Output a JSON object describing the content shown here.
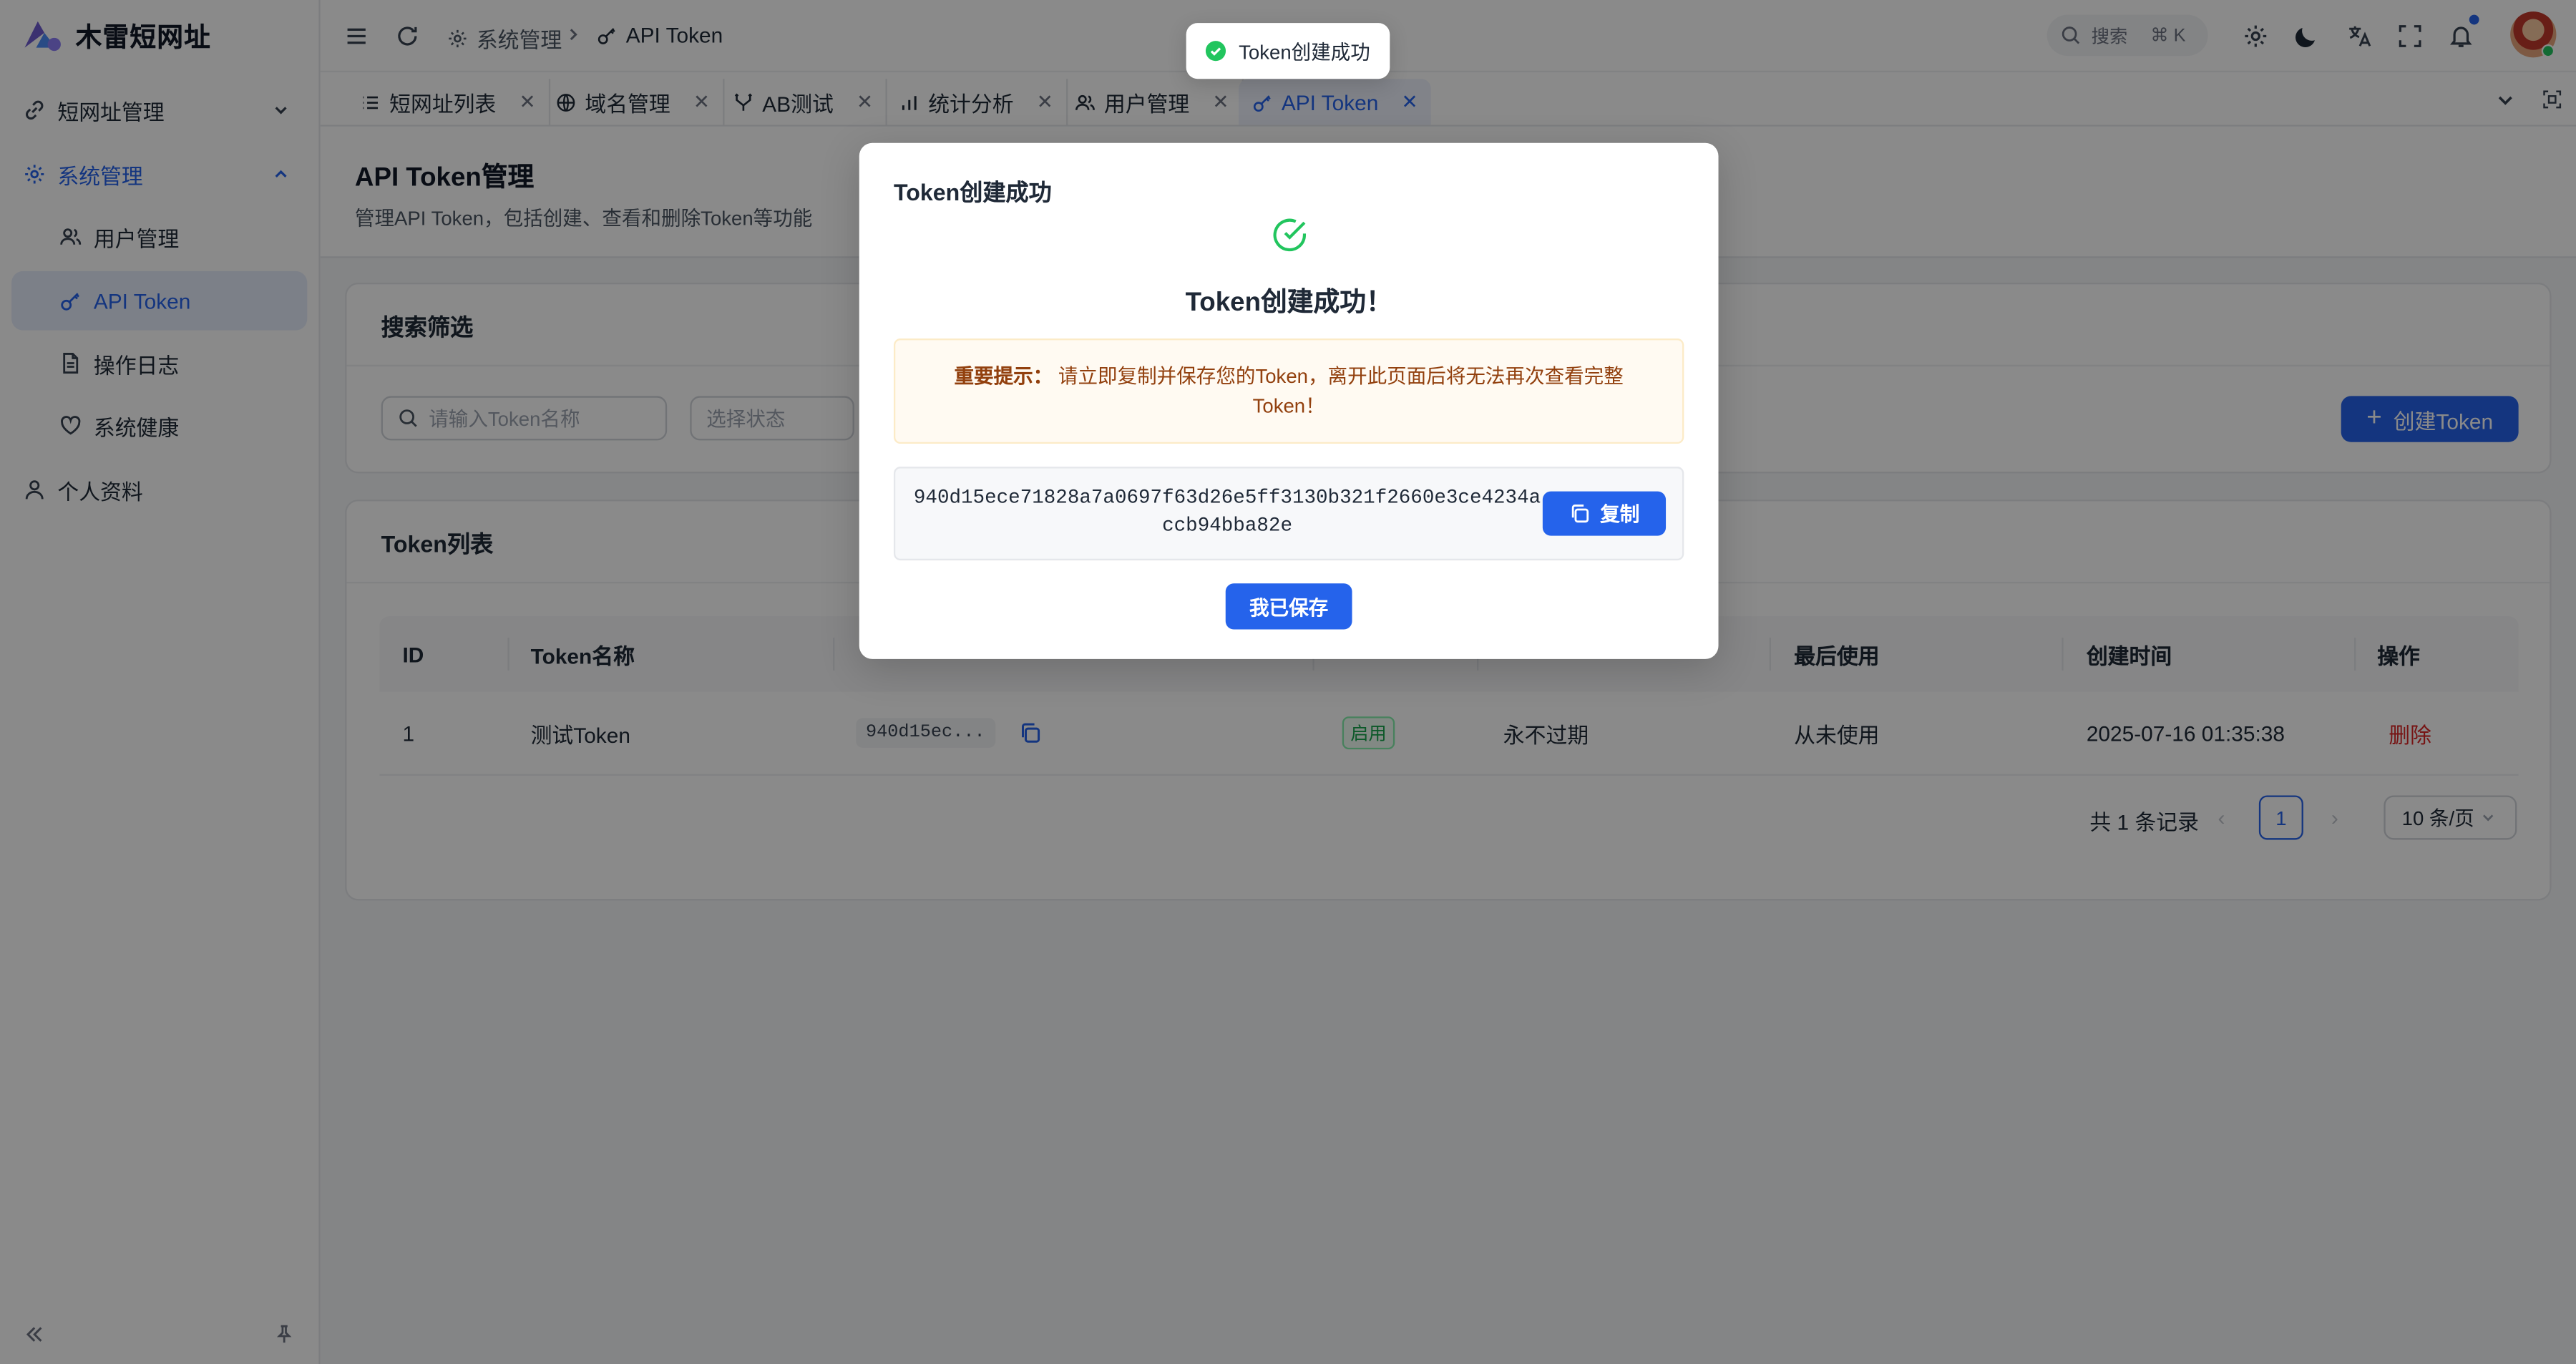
{
  "app": {
    "title": "木雷短网址"
  },
  "sidebar": {
    "groups": [
      {
        "label": "短网址管理",
        "icon": "link-icon"
      },
      {
        "label": "系统管理",
        "icon": "gear-icon"
      }
    ],
    "sub_items": [
      {
        "label": "用户管理",
        "icon": "users-icon"
      },
      {
        "label": "API Token",
        "icon": "key-icon"
      },
      {
        "label": "操作日志",
        "icon": "file-text-icon"
      },
      {
        "label": "系统健康",
        "icon": "heart-icon"
      }
    ],
    "profile": {
      "label": "个人资料",
      "icon": "user-icon"
    },
    "selected": "API Token"
  },
  "header": {
    "breadcrumb": [
      {
        "label": "系统管理",
        "icon": "gear-icon"
      },
      {
        "label": "API Token",
        "icon": "key-icon"
      }
    ],
    "search": {
      "label": "搜索",
      "shortcut": "⌘ K"
    }
  },
  "tabs": [
    {
      "label": "短网址列表",
      "icon": "list-icon"
    },
    {
      "label": "域名管理",
      "icon": "globe-icon"
    },
    {
      "label": "AB测试",
      "icon": "split-icon"
    },
    {
      "label": "统计分析",
      "icon": "bar-chart-icon"
    },
    {
      "label": "用户管理",
      "icon": "users-icon"
    },
    {
      "label": "API Token",
      "icon": "key-icon",
      "active": true
    }
  ],
  "page": {
    "title": "API Token管理",
    "description": "管理API Token，包括创建、查看和删除Token等功能"
  },
  "filter": {
    "title": "搜索筛选",
    "name_placeholder": "请输入Token名称",
    "status_placeholder": "选择状态",
    "create_button": "创建Token"
  },
  "token_list": {
    "title": "Token列表",
    "columns": [
      "ID",
      "Token名称",
      "",
      "",
      "",
      "最后使用",
      "创建时间",
      "操作"
    ],
    "rows": [
      {
        "id": "1",
        "name": "测试Token",
        "token": "940d15ec...",
        "status": "启用",
        "expiry": "永不过期",
        "last_used": "从未使用",
        "created": "2025-07-16 01:35:38",
        "action": "删除"
      }
    ],
    "pagination": {
      "total": "共 1 条记录",
      "page": "1",
      "page_size": "10 条/页"
    }
  },
  "modal": {
    "title": "Token创建成功",
    "heading": "Token创建成功！",
    "warning_label": "重要提示：",
    "warning_text": "请立即复制并保存您的Token，离开此页面后将无法再次查看完整Token！",
    "token": "940d15ece71828a7a0697f63d26e5ff3130b321f2660e3ce4234accb94bba82e",
    "copy_button": "复制",
    "confirm_button": "我已保存"
  },
  "toast": {
    "message": "Token创建成功"
  },
  "colors": {
    "primary": "#2563eb",
    "success": "#22c55e",
    "danger": "#dc2626",
    "warning_text": "#92400e"
  }
}
